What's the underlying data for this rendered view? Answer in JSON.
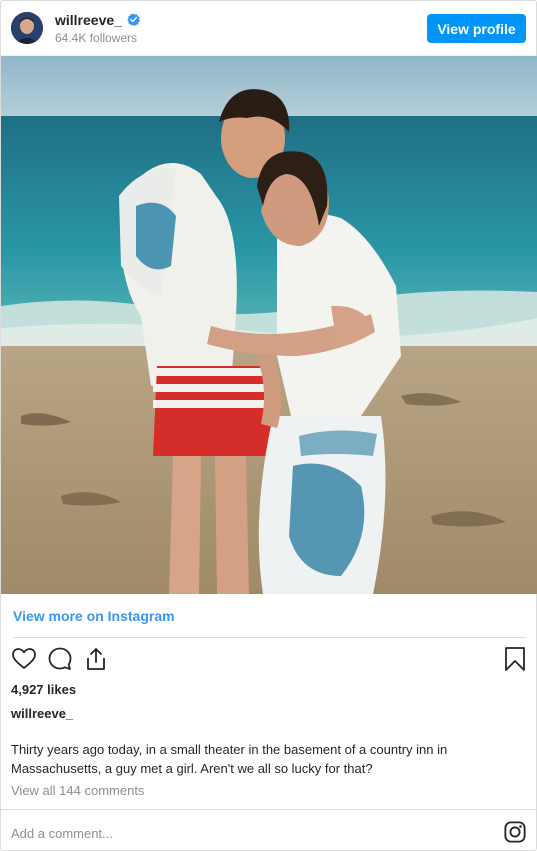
{
  "header": {
    "username": "willreeve_",
    "followers": "64.4K followers",
    "view_profile_label": "View profile",
    "verified_icon": "verified-badge-icon",
    "avatar_icon": "profile-avatar"
  },
  "post": {
    "view_more_label": "View more on Instagram",
    "likes": "4,927 likes",
    "caption_username": "willreeve_",
    "caption": "Thirty years ago today, in a small theater in the basement of a country inn in Massachusetts, a guy met a girl. Aren't we all so lucky for that?",
    "comments_link": "View all 144 comments",
    "add_comment_placeholder": "Add a comment..."
  },
  "icons": {
    "like": "heart-icon",
    "comment": "comment-icon",
    "share": "share-icon",
    "save": "bookmark-icon",
    "brand": "instagram-logo-icon"
  },
  "colors": {
    "accent": "#0095f6",
    "link": "#3897f0",
    "muted": "#8e8e8e"
  }
}
